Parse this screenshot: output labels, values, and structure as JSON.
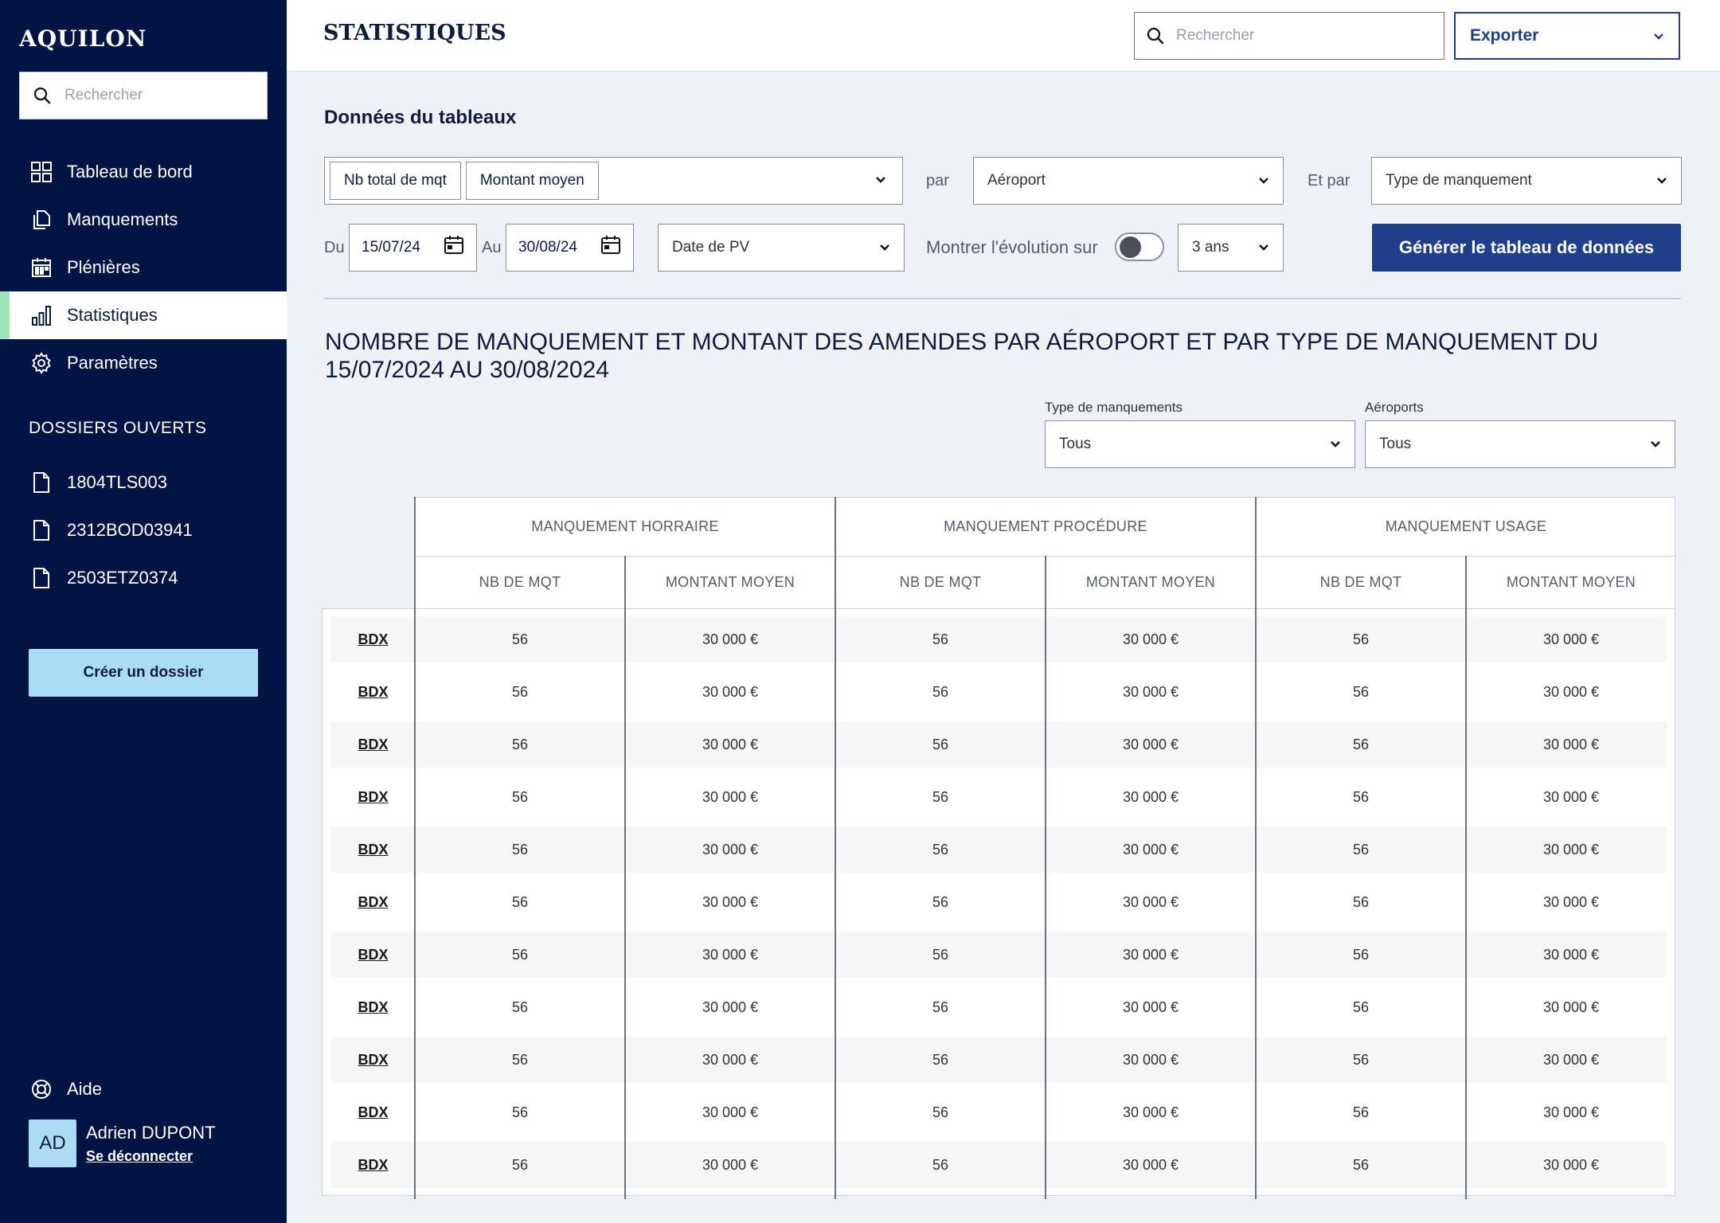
{
  "app": {
    "name": "AQUILON"
  },
  "sidebar": {
    "search_placeholder": "Rechercher",
    "nav": [
      {
        "label": "Tableau de bord",
        "icon": "grid-icon"
      },
      {
        "label": "Manquements",
        "icon": "documents-icon"
      },
      {
        "label": "Plénières",
        "icon": "calendar-icon"
      },
      {
        "label": "Statistiques",
        "icon": "bar-chart-icon",
        "active": true
      },
      {
        "label": "Paramètres",
        "icon": "gear-icon"
      }
    ],
    "dossiers_title": "DOSSIERS OUVERTS",
    "dossiers": [
      "1804TLS003",
      "2312BOD03941",
      "2503ETZ0374"
    ],
    "create_label": "Créer un dossier",
    "help_label": "Aide",
    "user": {
      "initials": "AD",
      "name": "Adrien DUPONT",
      "logout": "Se déconnecter"
    }
  },
  "header": {
    "title": "STATISTIQUES",
    "search_placeholder": "Rechercher",
    "export_label": "Exporter"
  },
  "form": {
    "heading": "Données du tableaux",
    "metrics": [
      "Nb total de mqt",
      "Montant moyen"
    ],
    "par_label": "par",
    "par_value": "Aéroport",
    "etpar_label": "Et par",
    "etpar_value": "Type de manquement",
    "du_label": "Du",
    "du_value": "15/07/24",
    "au_label": "Au",
    "au_value": "30/08/24",
    "date_type": "Date de PV",
    "evolution_label": "Montrer l'évolution sur",
    "evolution_value": "3 ans",
    "evolution_enabled": false,
    "generate_label": "Générer le tableau de données"
  },
  "report": {
    "title": "NOMBRE DE MANQUEMENT ET MONTANT DES AMENDES PAR AÉROPORT ET PAR TYPE DE MANQUEMENT DU 15/07/2024 AU 30/08/2024",
    "filter_type_label": "Type de manquements",
    "filter_type_value": "Tous",
    "filter_airport_label": "Aéroports",
    "filter_airport_value": "Tous",
    "groups": [
      "MANQUEMENT HORRAIRE",
      "MANQUEMENT PROCÉDURE",
      "MANQUEMENT USAGE"
    ],
    "subcols": [
      "NB DE MQT",
      "MONTANT MOYEN"
    ],
    "rows": [
      {
        "label": "BDX",
        "values": [
          "56",
          "30 000 €",
          "56",
          "30 000 €",
          "56",
          "30 000 €"
        ]
      },
      {
        "label": "BDX",
        "values": [
          "56",
          "30 000 €",
          "56",
          "30 000 €",
          "56",
          "30 000 €"
        ]
      },
      {
        "label": "BDX",
        "values": [
          "56",
          "30 000 €",
          "56",
          "30 000 €",
          "56",
          "30 000 €"
        ]
      },
      {
        "label": "BDX",
        "values": [
          "56",
          "30 000 €",
          "56",
          "30 000 €",
          "56",
          "30 000 €"
        ]
      },
      {
        "label": "BDX",
        "values": [
          "56",
          "30 000 €",
          "56",
          "30 000 €",
          "56",
          "30 000 €"
        ]
      },
      {
        "label": "BDX",
        "values": [
          "56",
          "30 000 €",
          "56",
          "30 000 €",
          "56",
          "30 000 €"
        ]
      },
      {
        "label": "BDX",
        "values": [
          "56",
          "30 000 €",
          "56",
          "30 000 €",
          "56",
          "30 000 €"
        ]
      },
      {
        "label": "BDX",
        "values": [
          "56",
          "30 000 €",
          "56",
          "30 000 €",
          "56",
          "30 000 €"
        ]
      },
      {
        "label": "BDX",
        "values": [
          "56",
          "30 000 €",
          "56",
          "30 000 €",
          "56",
          "30 000 €"
        ]
      },
      {
        "label": "BDX",
        "values": [
          "56",
          "30 000 €",
          "56",
          "30 000 €",
          "56",
          "30 000 €"
        ]
      },
      {
        "label": "BDX",
        "values": [
          "56",
          "30 000 €",
          "56",
          "30 000 €",
          "56",
          "30 000 €"
        ]
      }
    ]
  },
  "colors": {
    "sidebar_bg": "#011444",
    "primary": "#1f3f8a",
    "accent_light": "#aadcf5",
    "active_marker": "#9ee6b8"
  }
}
